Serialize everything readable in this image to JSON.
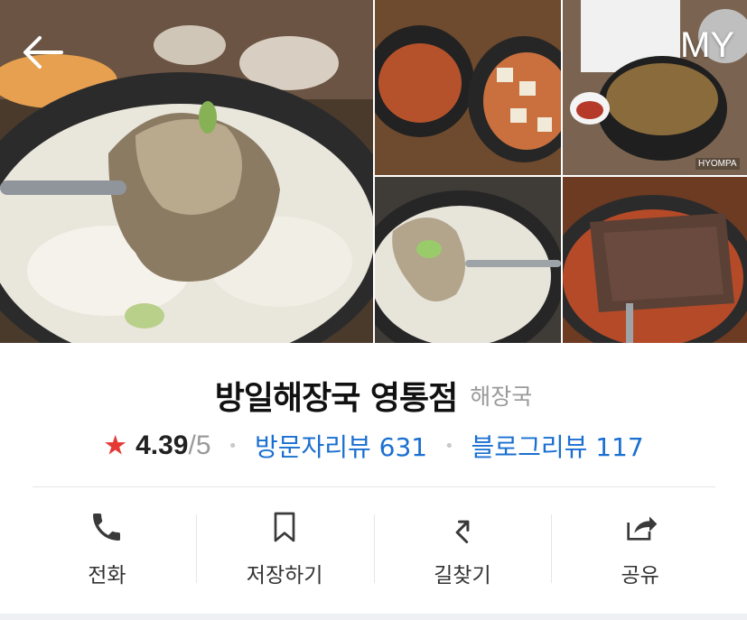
{
  "header": {
    "back_icon": "arrow-left-icon",
    "my_label": "MY",
    "watermark": "HYOMPA"
  },
  "place": {
    "name": "방일해장국 영통점",
    "category": "해장국",
    "rating": "4.39",
    "rating_max": "/5",
    "visitor_reviews_label": "방문자리뷰 631",
    "blog_reviews_label": "블로그리뷰 117"
  },
  "actions": [
    {
      "label": "전화",
      "icon": "phone-icon"
    },
    {
      "label": "저장하기",
      "icon": "bookmark-icon"
    },
    {
      "label": "길찾기",
      "icon": "directions-icon"
    },
    {
      "label": "공유",
      "icon": "share-icon"
    }
  ],
  "colors": {
    "star": "#e53935",
    "link": "#1a6fd1",
    "muted": "#9a9a9a"
  }
}
